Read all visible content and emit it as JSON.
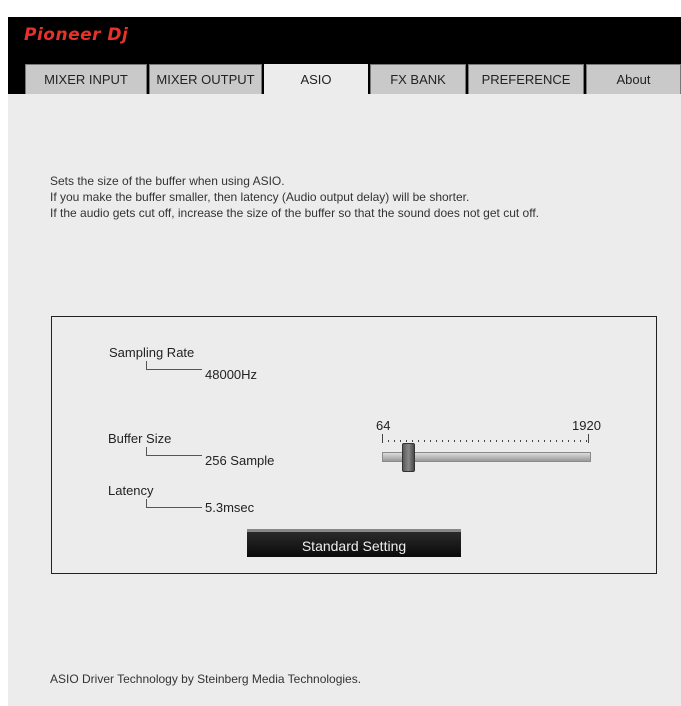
{
  "app": {
    "logo": "Pioneer Dj"
  },
  "tabs": [
    {
      "label": "MIXER INPUT"
    },
    {
      "label": "MIXER OUTPUT"
    },
    {
      "label": "ASIO"
    },
    {
      "label": "FX BANK"
    },
    {
      "label": "PREFERENCE"
    },
    {
      "label": "About"
    }
  ],
  "active_tab": "ASIO",
  "description": {
    "line1": "Sets the size of the buffer when using ASIO.",
    "line2": "If you make the buffer smaller, then latency (Audio output delay) will be shorter.",
    "line3": "If the audio gets cut off, increase the size of the buffer so that the sound does not get cut off."
  },
  "sampling_rate": {
    "label": "Sampling Rate",
    "value": "48000Hz"
  },
  "buffer_size": {
    "label": "Buffer Size",
    "value": "256 Sample",
    "slider_min": "64",
    "slider_max": "1920",
    "slider_fraction": 0.1
  },
  "latency": {
    "label": "Latency",
    "value": "5.3msec"
  },
  "standard_button": {
    "label": "Standard Setting"
  },
  "footer": "ASIO Driver Technology by Steinberg Media Technologies.",
  "colors": {
    "logo": "#e5322b",
    "background": "#ececec",
    "topbar": "#000000"
  }
}
